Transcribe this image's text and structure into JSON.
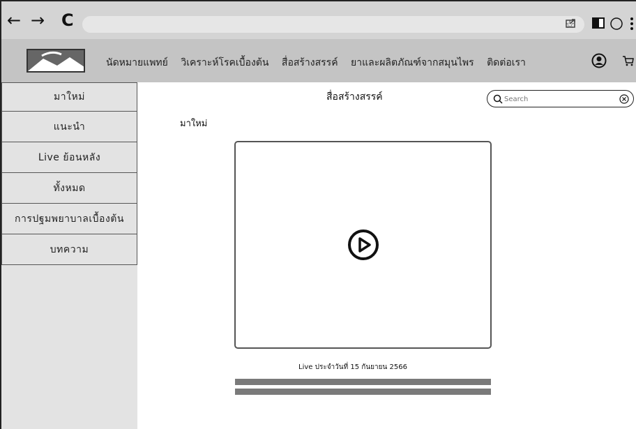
{
  "browser": {
    "back_icon": "←",
    "forward_icon": "→",
    "reload_icon": "C",
    "url": ""
  },
  "header": {
    "nav": [
      "นัดหมายแพทย์",
      "วิเคราะห์โรคเบื้องต้น",
      "สื่อสร้างสรรค์",
      "ยาและผลิตภัณฑ์จากสมุนไพร",
      "ติดต่อเรา"
    ]
  },
  "sidebar": {
    "items": [
      "มาใหม่",
      "แนะนำ",
      "Live ย้อนหลัง",
      "ทั้งหมด",
      "การปฐมพยาบาลเบื้องต้น",
      "บทความ"
    ]
  },
  "main": {
    "title": "สื่อสร้างสรรค์",
    "section": "มาใหม่",
    "caption": "Live ประจำวันที่ 15 กันยายน 2566"
  },
  "search": {
    "placeholder": "Search",
    "value": ""
  },
  "colors": {
    "browser_bar": "#d4d4d4",
    "header": "#c4c4c4",
    "sidebar": "#e3e3e3",
    "progress_bar": "#7a7a7a"
  }
}
